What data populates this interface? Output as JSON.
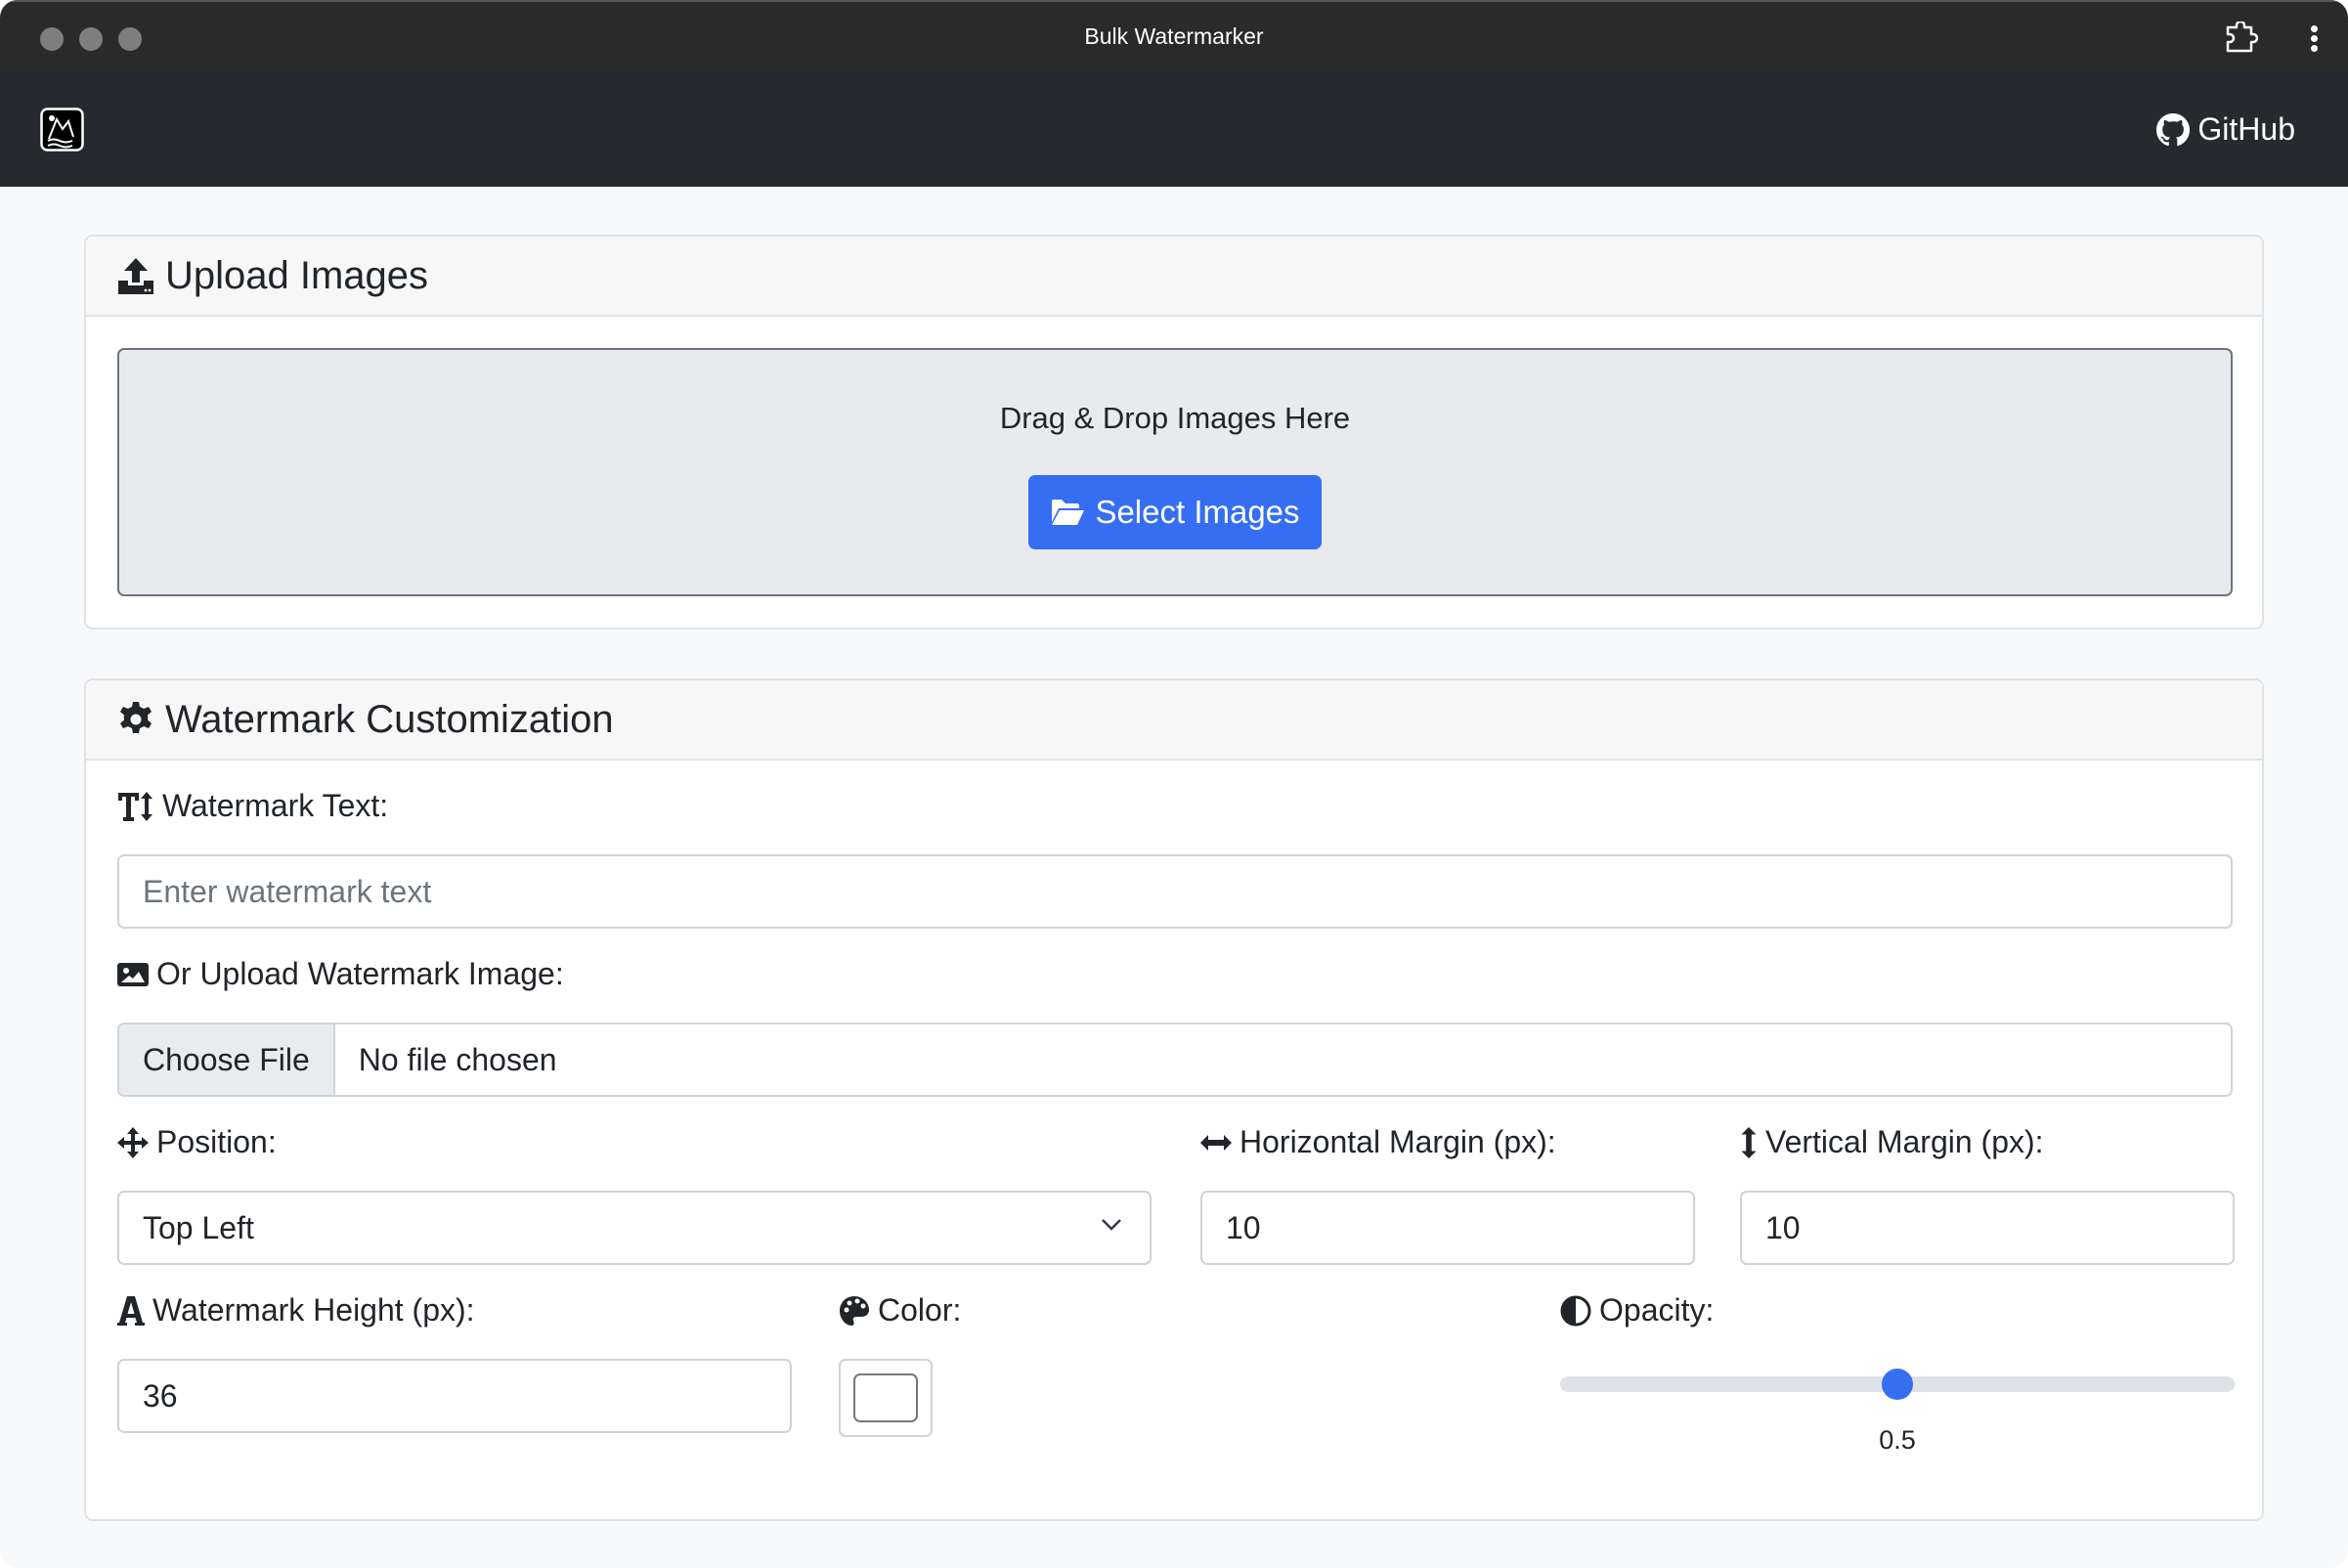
{
  "window": {
    "title": "Bulk Watermarker"
  },
  "navbar": {
    "brand_icon": "image-logo-icon",
    "github_label": "GitHub"
  },
  "upload": {
    "title": "Upload Images",
    "dropzone_text": "Drag & Drop Images Here",
    "select_button": "Select Images"
  },
  "customization": {
    "title": "Watermark Customization",
    "text_label": "Watermark Text:",
    "text_placeholder": "Enter watermark text",
    "text_value": "",
    "image_label": "Or Upload Watermark Image:",
    "choose_file": "Choose File",
    "no_file": "No file chosen",
    "position_label": "Position:",
    "position_value": "Top Left",
    "hmargin_label": "Horizontal Margin (px):",
    "hmargin_value": "10",
    "vmargin_label": "Vertical Margin (px):",
    "vmargin_value": "10",
    "height_label": "Watermark Height (px):",
    "height_value": "36",
    "color_label": "Color:",
    "color_value": "#ffffff",
    "opacity_label": "Opacity:",
    "opacity_value": 0.5,
    "opacity_display": "0.5",
    "opacity_min": 0,
    "opacity_max": 1
  },
  "colors": {
    "primary": "#356ef2",
    "navbar": "#262a2e",
    "titlebar": "#2a2a2a"
  }
}
